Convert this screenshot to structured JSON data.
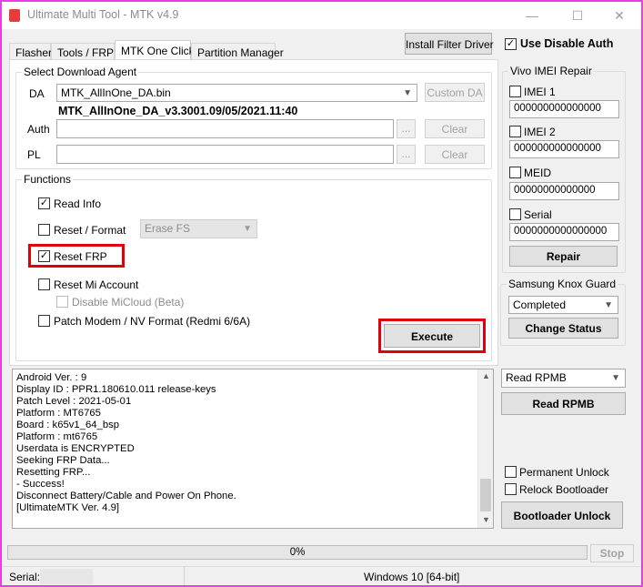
{
  "window": {
    "title": "Ultimate Multi Tool - MTK v4.9",
    "minimize": "—",
    "maximize": "☐",
    "close": "✕"
  },
  "tabs": [
    {
      "label": "Flasher"
    },
    {
      "label": "Tools / FRP"
    },
    {
      "label": "MTK One Click"
    },
    {
      "label": "Partition Manager"
    }
  ],
  "top": {
    "install_filter_driver": "Install Filter Driver",
    "use_disable_auth": "Use Disable Auth",
    "use_disable_auth_checked": true
  },
  "download_agent": {
    "legend": "Select Download Agent",
    "da_label": "DA",
    "da_value": "MTK_AllInOne_DA.bin",
    "custom_da": "Custom DA",
    "da_info": "MTK_AllInOne_DA_v3.3001.09/05/2021.11:40",
    "auth_label": "Auth",
    "pl_label": "PL",
    "browse": "...",
    "clear": "Clear"
  },
  "functions": {
    "legend": "Functions",
    "read_info": {
      "label": "Read Info",
      "checked": true
    },
    "reset_format": {
      "label": "Reset / Format",
      "checked": false
    },
    "format_option": "Erase FS",
    "reset_frp": {
      "label": "Reset FRP",
      "checked": true
    },
    "reset_mi_account": {
      "label": "Reset Mi Account",
      "checked": false
    },
    "disable_micloud": {
      "label": "Disable MiCloud (Beta)",
      "checked": false
    },
    "patch_modem": {
      "label": "Patch Modem / NV Format (Redmi 6/6A)",
      "checked": false
    },
    "execute": "Execute"
  },
  "log": [
    "Android Ver. : 9",
    "Display ID : PPR1.180610.011 release-keys",
    "Patch Level : 2021-05-01",
    "Platform : MT6765",
    "Board : k65v1_64_bsp",
    "Platform : mt6765",
    "Userdata is ENCRYPTED",
    "Seeking FRP Data...",
    "Resetting FRP...",
    "- Success!",
    "Disconnect Battery/Cable and Power On Phone.",
    "[UltimateMTK Ver. 4.9]"
  ],
  "vivo": {
    "legend": "Vivo IMEI Repair",
    "imei1_label": "IMEI 1",
    "imei1_value": "000000000000000",
    "imei2_label": "IMEI 2",
    "imei2_value": "000000000000000",
    "meid_label": "MEID",
    "meid_value": "00000000000000",
    "serial_label": "Serial",
    "serial_value": "0000000000000000",
    "repair": "Repair"
  },
  "knox": {
    "legend": "Samsung Knox Guard",
    "status": "Completed",
    "change_status": "Change Status"
  },
  "rpmb": {
    "option": "Read RPMB",
    "read_rpmb": "Read RPMB",
    "permanent_unlock": "Permanent Unlock",
    "relock_bootloader": "Relock Bootloader",
    "bootloader_unlock": "Bootloader Unlock"
  },
  "progress": {
    "percent_text": "0%",
    "value": 0,
    "stop": "Stop"
  },
  "status_bar": {
    "serial_label": "Serial:",
    "os": "Windows 10 [64-bit]"
  },
  "colors": {
    "highlight": "#e0000a",
    "window_border": "#e63fe6"
  }
}
